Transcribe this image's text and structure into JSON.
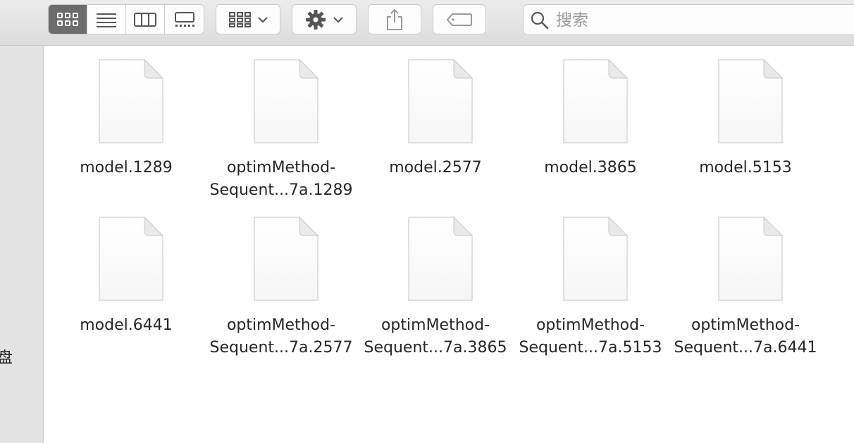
{
  "toolbar": {
    "view_modes": [
      {
        "name": "icon-view",
        "active": true
      },
      {
        "name": "list-view",
        "active": false
      },
      {
        "name": "column-view",
        "active": false
      },
      {
        "name": "gallery-view",
        "active": false
      }
    ],
    "group_button_icon": "group-grid-icon",
    "action_button_icon": "gear-icon",
    "share_button_icon": "share-icon",
    "tag_button_icon": "tag-icon"
  },
  "search": {
    "placeholder": "搜索"
  },
  "sidebar": {
    "visible_label": "盘"
  },
  "files": [
    {
      "line1": "model.1289",
      "line2": ""
    },
    {
      "line1": "optimMethod-",
      "line2": "Sequent...7a.1289"
    },
    {
      "line1": "model.2577",
      "line2": ""
    },
    {
      "line1": "model.3865",
      "line2": ""
    },
    {
      "line1": "model.5153",
      "line2": ""
    },
    {
      "line1": "model.6441",
      "line2": ""
    },
    {
      "line1": "optimMethod-",
      "line2": "Sequent...7a.2577"
    },
    {
      "line1": "optimMethod-",
      "line2": "Sequent...7a.3865"
    },
    {
      "line1": "optimMethod-",
      "line2": "Sequent...7a.5153"
    },
    {
      "line1": "optimMethod-",
      "line2": "Sequent...7a.6441"
    }
  ]
}
